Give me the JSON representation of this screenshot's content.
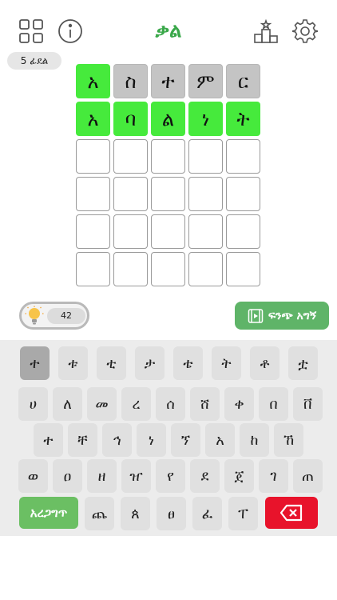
{
  "header": {
    "title": "ቃል",
    "letters_badge": "5 ፊደል"
  },
  "board": {
    "rows": [
      [
        {
          "ch": "አ",
          "state": "correct"
        },
        {
          "ch": "ስ",
          "state": "absent"
        },
        {
          "ch": "ተ",
          "state": "absent"
        },
        {
          "ch": "ም",
          "state": "absent"
        },
        {
          "ch": "ር",
          "state": "absent"
        }
      ],
      [
        {
          "ch": "አ",
          "state": "correct"
        },
        {
          "ch": "ባ",
          "state": "correct"
        },
        {
          "ch": "ል",
          "state": "correct"
        },
        {
          "ch": "ነ",
          "state": "correct"
        },
        {
          "ch": "ት",
          "state": "correct"
        }
      ],
      [
        {
          "ch": "",
          "state": "empty"
        },
        {
          "ch": "",
          "state": "empty"
        },
        {
          "ch": "",
          "state": "empty"
        },
        {
          "ch": "",
          "state": "empty"
        },
        {
          "ch": "",
          "state": "empty"
        }
      ],
      [
        {
          "ch": "",
          "state": "empty"
        },
        {
          "ch": "",
          "state": "empty"
        },
        {
          "ch": "",
          "state": "empty"
        },
        {
          "ch": "",
          "state": "empty"
        },
        {
          "ch": "",
          "state": "empty"
        }
      ],
      [
        {
          "ch": "",
          "state": "empty"
        },
        {
          "ch": "",
          "state": "empty"
        },
        {
          "ch": "",
          "state": "empty"
        },
        {
          "ch": "",
          "state": "empty"
        },
        {
          "ch": "",
          "state": "empty"
        }
      ],
      [
        {
          "ch": "",
          "state": "empty"
        },
        {
          "ch": "",
          "state": "empty"
        },
        {
          "ch": "",
          "state": "empty"
        },
        {
          "ch": "",
          "state": "empty"
        },
        {
          "ch": "",
          "state": "empty"
        }
      ]
    ]
  },
  "hints": {
    "count": "42",
    "watch_label": "ፍንጭ አግኝ"
  },
  "keyboard": {
    "row1": [
      "ተ",
      "ቱ",
      "ቲ",
      "ታ",
      "ቴ",
      "ት",
      "ቶ",
      "ቷ"
    ],
    "row2": [
      "ሀ",
      "ለ",
      "መ",
      "ረ",
      "ሰ",
      "ሸ",
      "ቀ",
      "በ",
      "ቨ"
    ],
    "row3": [
      "ተ",
      "ቸ",
      "ኅ",
      "ነ",
      "ኘ",
      "አ",
      "ከ",
      "ኸ"
    ],
    "row4": [
      "ወ",
      "ዐ",
      "ዘ",
      "ዠ",
      "የ",
      "ደ",
      "ጀ",
      "ገ",
      "ጠ"
    ],
    "row5_enter": "አረጋግጥ",
    "row5": [
      "ጨ",
      "ጰ",
      "ፀ",
      "ፈ",
      "ፐ"
    ]
  },
  "colors": {
    "correct": "#46ea3c",
    "absent": "#c4c4c4",
    "accent": "#3aa84a",
    "delete": "#e8132b"
  }
}
